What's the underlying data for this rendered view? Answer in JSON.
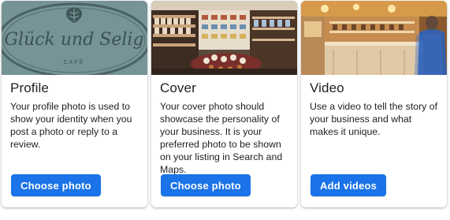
{
  "cards": [
    {
      "title": "Profile",
      "description": "Your profile photo is used to show your identity when you post a photo or reply to a review.",
      "button_label": "Choose photo",
      "image": {
        "logo_script": "Glück und Selig",
        "logo_subtext": "CAFÉ"
      }
    },
    {
      "title": "Cover",
      "description": "Your cover photo should showcase the personality of your business. It is your preferred photo to be shown on your listing in Search and Maps.",
      "button_label": "Choose photo"
    },
    {
      "title": "Video",
      "description": "Use a video to tell the story of your business and what makes it unique.",
      "button_label": "Add videos"
    }
  ],
  "colors": {
    "primary_button": "#1a73e8",
    "text": "#202124"
  }
}
